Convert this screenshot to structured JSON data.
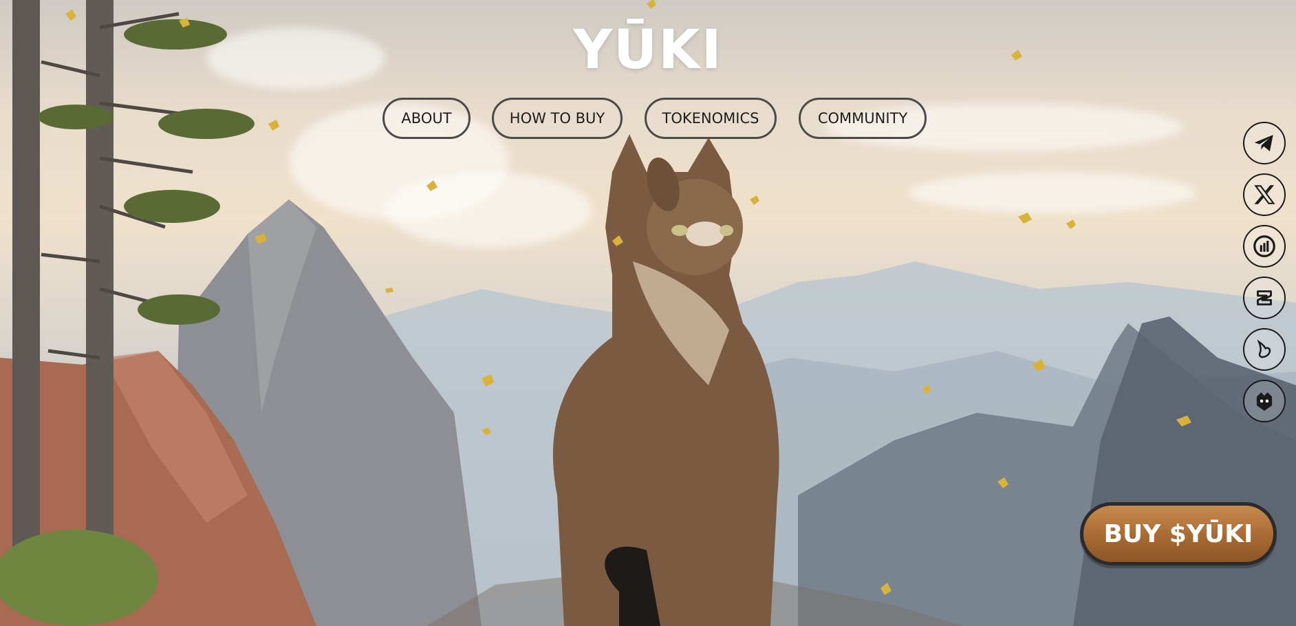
{
  "brand": {
    "logo_text": "YŪKI"
  },
  "nav": {
    "items": [
      {
        "label": "ABOUT"
      },
      {
        "label": "HOW TO BUY"
      },
      {
        "label": "TOKENOMICS"
      },
      {
        "label": "COMMUNITY"
      }
    ]
  },
  "social": {
    "items": [
      {
        "icon": "telegram-icon"
      },
      {
        "icon": "x-twitter-icon"
      },
      {
        "icon": "dexscreener-icon"
      },
      {
        "icon": "coingecko-icon"
      },
      {
        "icon": "uniswap-icon"
      },
      {
        "icon": "etherscan-icon"
      }
    ]
  },
  "cta": {
    "buy_label": "BUY $YŪKI"
  },
  "colors": {
    "cta_top": "#c78a4e",
    "cta_bottom": "#8b5628",
    "nav_border": "#4a4a4a",
    "logo": "#ffffff",
    "leaf": "#d9b23a"
  }
}
